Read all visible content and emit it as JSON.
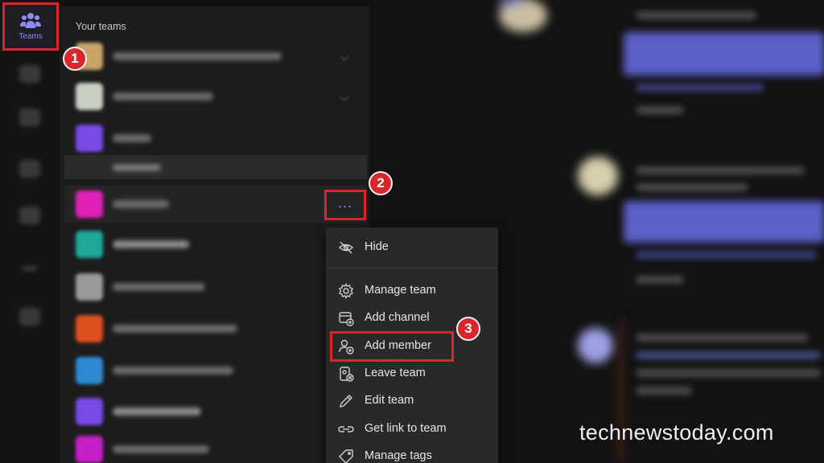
{
  "rail": {
    "teams_label": "Teams"
  },
  "team_pane": {
    "section_title": "Your teams",
    "teams": [
      {
        "avatar_color": "#caa56a"
      },
      {
        "avatar_color": "#c8cfc2"
      },
      {
        "avatar_color": "#7a4ae6"
      },
      {
        "avatar_color": "#e020b8"
      },
      {
        "avatar_color": "#1fa89a"
      },
      {
        "avatar_color": "#9a9a9a"
      },
      {
        "avatar_color": "#e0501f"
      },
      {
        "avatar_color": "#2d8bd6"
      },
      {
        "avatar_color": "#7a4ae6"
      },
      {
        "avatar_color": "#c81ec8"
      }
    ],
    "more_options_glyph": "..."
  },
  "context_menu": {
    "items": [
      {
        "label": "Hide",
        "icon": "hide-icon"
      },
      {
        "label": "Manage team",
        "icon": "gear-icon"
      },
      {
        "label": "Add channel",
        "icon": "add-channel-icon"
      },
      {
        "label": "Add member",
        "icon": "add-member-icon"
      },
      {
        "label": "Leave team",
        "icon": "leave-team-icon"
      },
      {
        "label": "Edit team",
        "icon": "pencil-icon"
      },
      {
        "label": "Get link to team",
        "icon": "link-icon"
      },
      {
        "label": "Manage tags",
        "icon": "tag-icon"
      }
    ]
  },
  "annotations": {
    "step1": "1",
    "step2": "2",
    "step3": "3",
    "highlight_color": "#d9262c"
  },
  "watermark": "technewstoday.com",
  "colors": {
    "accent": "#8b8cf0",
    "teams_purple": "#5b5fc7"
  }
}
